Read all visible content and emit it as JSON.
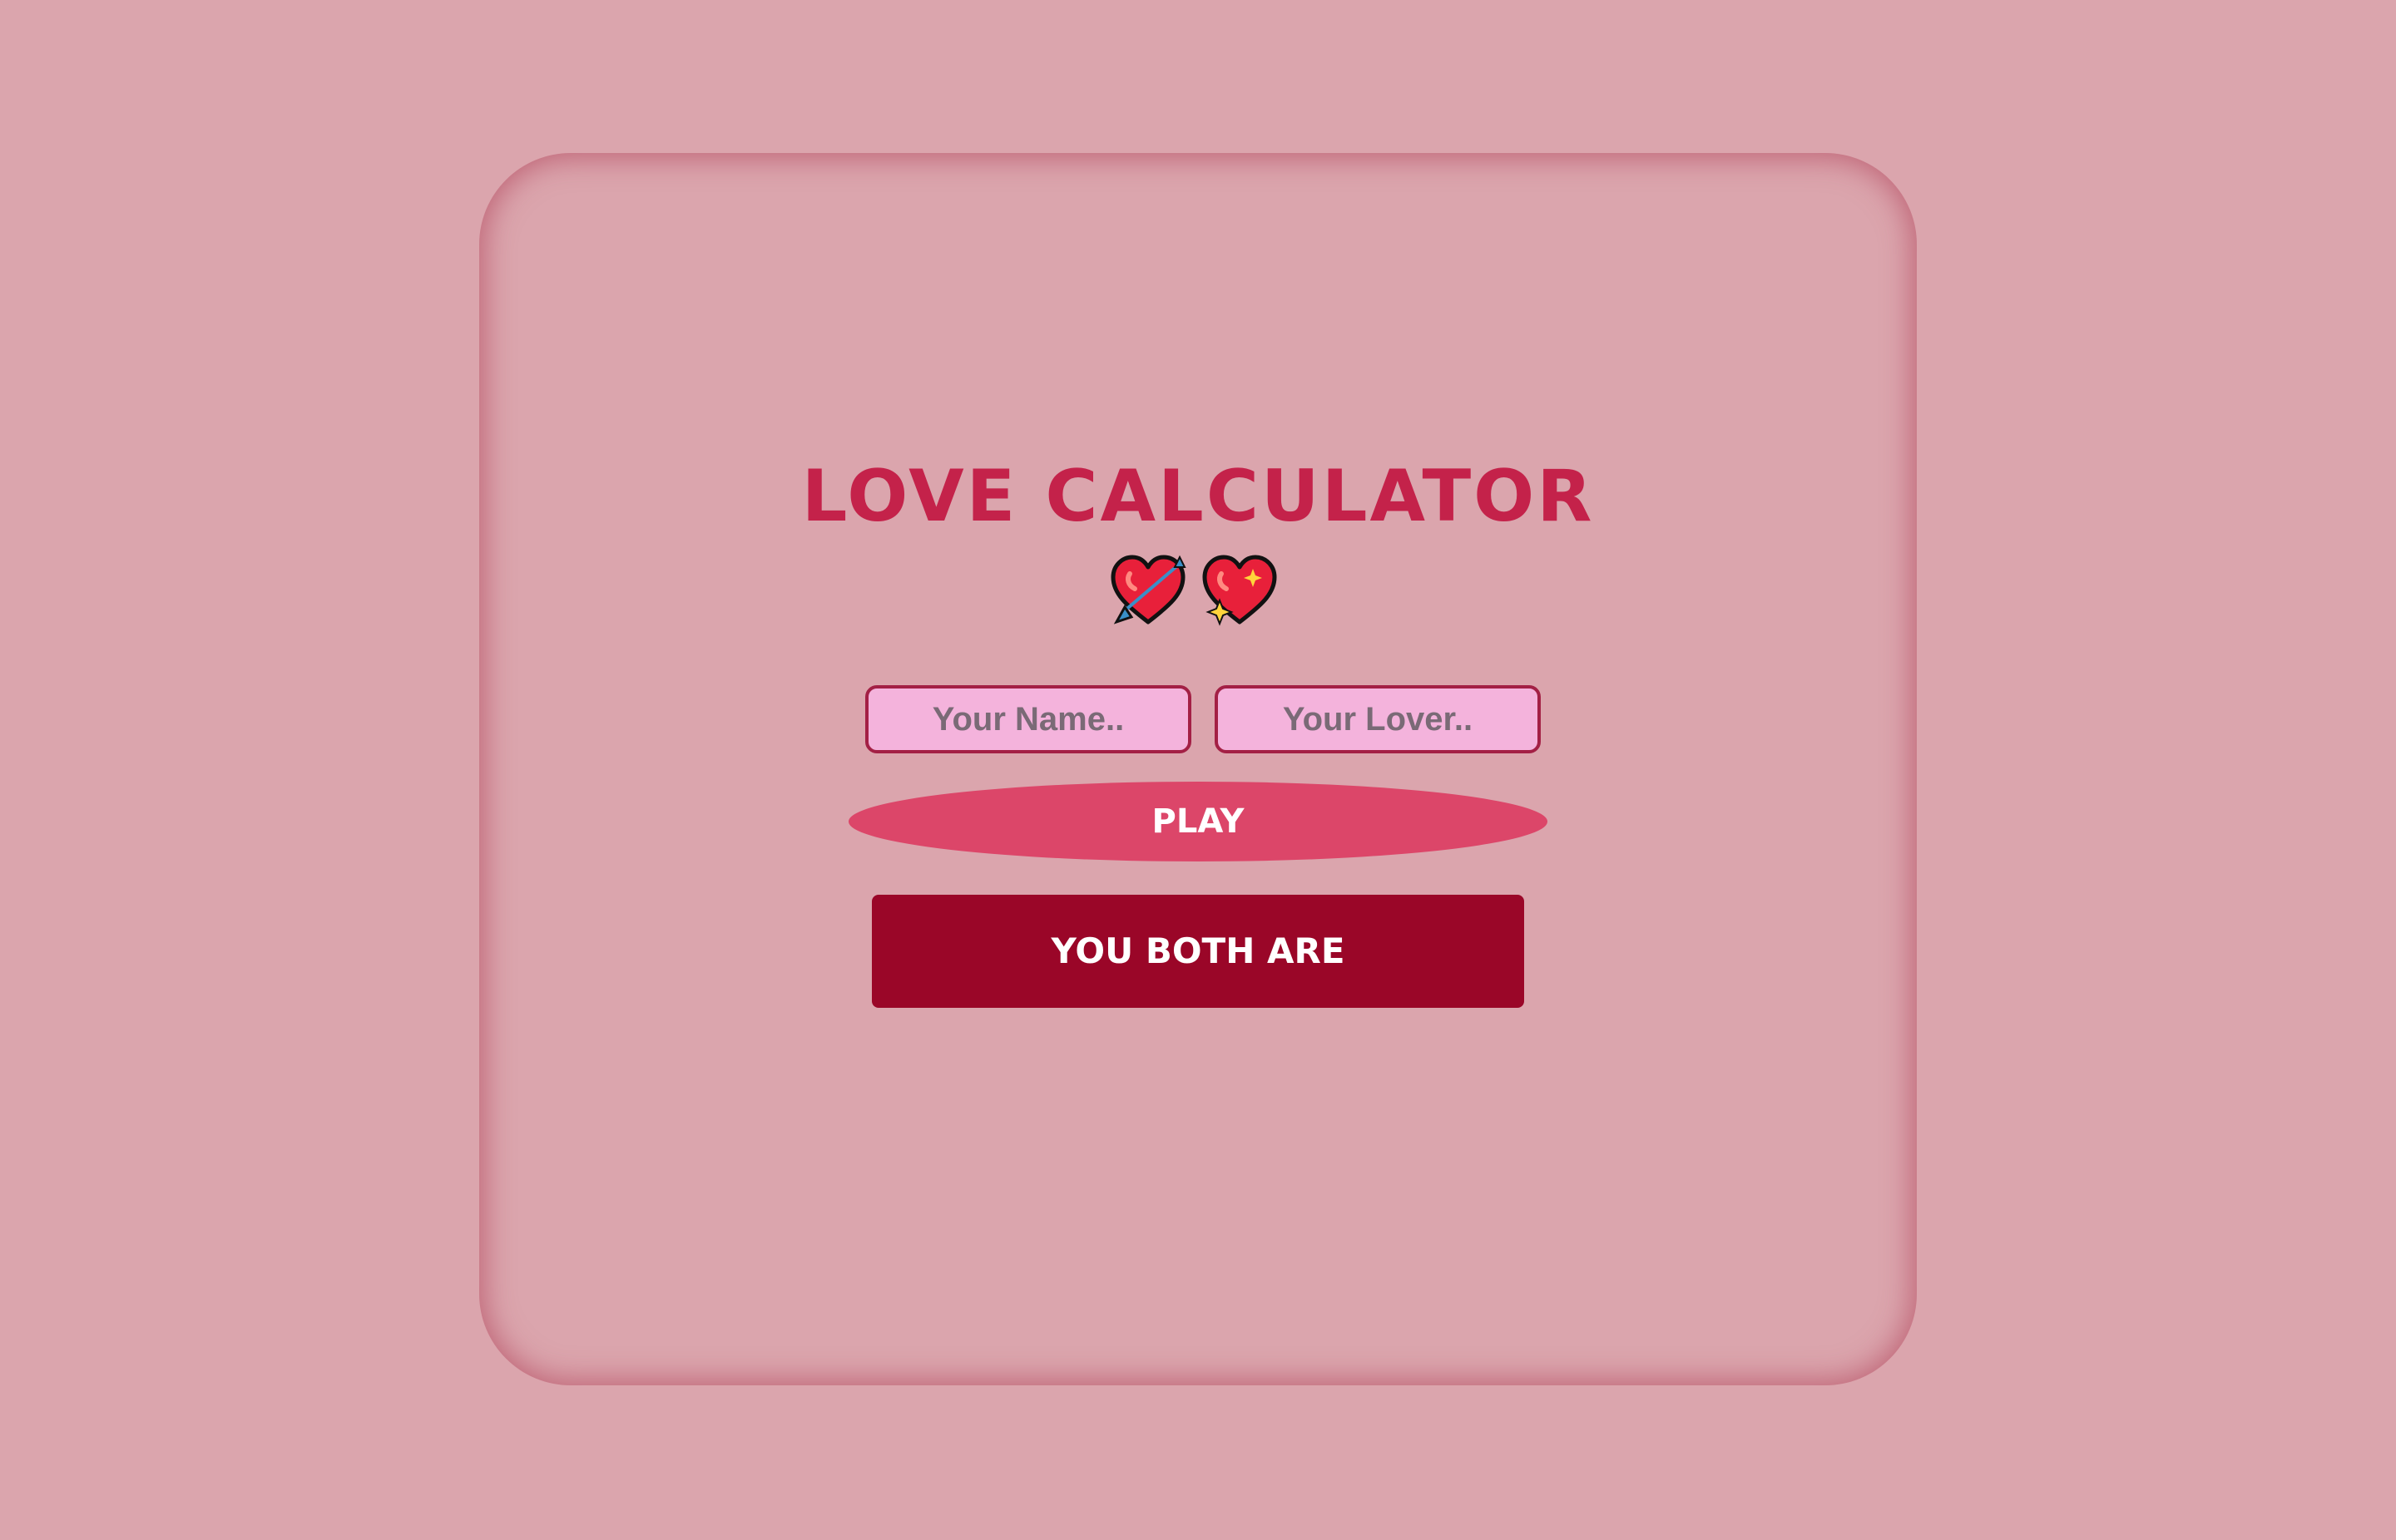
{
  "title": "LOVE CALCULATOR",
  "icons": [
    "heart-with-arrow-icon",
    "sparkling-heart-icon"
  ],
  "inputs": {
    "name_placeholder": "Your Name..",
    "name_value": "",
    "lover_placeholder": "Your Lover..",
    "lover_value": ""
  },
  "play_label": "PLAY",
  "result_text": "YOU BOTH ARE",
  "colors": {
    "background": "#dba5ad",
    "title": "#c4224a",
    "input_fill": "#f4b3dc",
    "input_border": "#a32045",
    "play_button": "#dc4669",
    "result_box": "#9a0628"
  }
}
